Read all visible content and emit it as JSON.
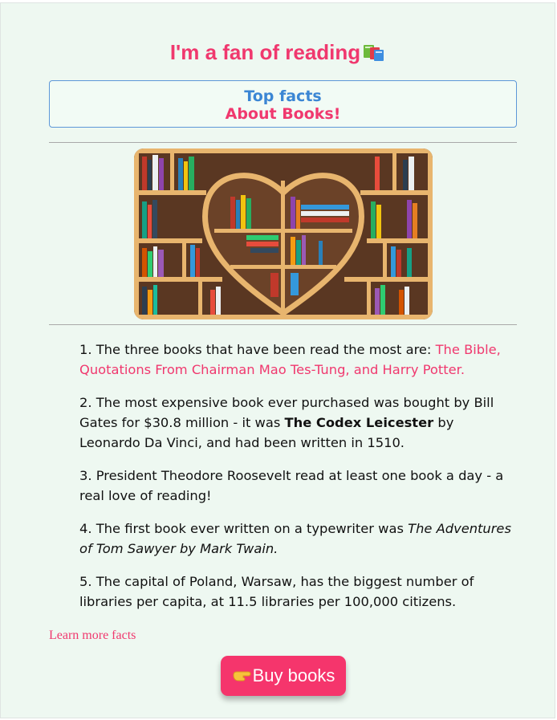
{
  "page": {
    "title": "I'm a fan of reading",
    "title_icon": "books-icon",
    "facts_heading": {
      "line1": "Top facts",
      "line2": "About Books!"
    },
    "image": {
      "description_icon": "heart-bookshelf-image"
    },
    "facts": [
      {
        "number": "1.",
        "text": "The three books that have been read the most are:",
        "highlight": "The Bible, Quotations From Chairman Mao Tes-Tung, and Harry Potter."
      },
      {
        "number": "2.",
        "text_before": "The most expensive book ever purchased was bought by Bill Gates for $30.8 million - it was",
        "bold": "The Codex Leicester",
        "text_after": "by Leonardo Da Vinci, and had been written in 1510."
      },
      {
        "number": "3.",
        "text": "President Theodore Roosevelt read at least one book a day - a real love of reading!"
      },
      {
        "number": "4.",
        "text": "The first book ever written on a typewriter was",
        "italic": "The Adventures of Tom Sawyer by Mark Twain."
      },
      {
        "number": "5.",
        "text": "The capital of Poland, Warsaw, has the biggest number of libraries per capita, at 11.5 libraries per 100,000 citizens."
      }
    ],
    "learn_more": "Learn more facts",
    "buy_button": {
      "icon": "pointing-hand-icon",
      "label": "Buy books"
    }
  },
  "colors": {
    "accent_pink": "#f0386e",
    "accent_blue": "#3b86d4",
    "background": "#eef8f1"
  }
}
